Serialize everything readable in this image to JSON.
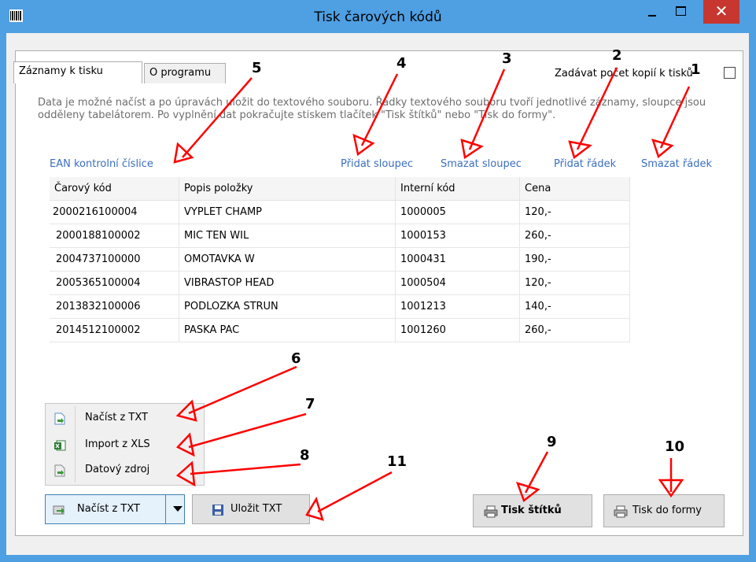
{
  "window": {
    "title": "Tisk čarových kódů"
  },
  "tabs": [
    {
      "label": "Záznamy k tisku"
    },
    {
      "label": "O programu"
    }
  ],
  "copies_option": {
    "label": "Zadávat počet kopií k tisků",
    "checked": false
  },
  "info_text": "Data je možné  načíst a po úpravách  uložit do  textového  souboru.  Řádky  textového souboru tvoří jednotlivé záznamy, sloupce jsou odděleny tabelátorem. Po vyplnění dat pokračujte stiskem tlačítek \"Tisk štítků\" nebo \"Tisk do formy\".",
  "links": {
    "ean_check": "EAN kontrolní číslice",
    "add_column": "Přidat sloupec",
    "delete_column": "Smazat sloupec",
    "add_row": "Přidat řádek",
    "delete_row": "Smazat řádek"
  },
  "table": {
    "columns": [
      "Čarový kód",
      "Popis položky",
      "Interní kód",
      "Cena"
    ],
    "rows": [
      [
        "2000216100004",
        "VYPLET CHAMP",
        "1000005",
        "120,-"
      ],
      [
        "2000188100002",
        "MIC TEN WIL",
        "1000153",
        "260,-"
      ],
      [
        "2004737100000",
        "OMOTAVKA W",
        "1000431",
        "190,-"
      ],
      [
        "2005365100004",
        "VIBRASTOP HEAD",
        "1000504",
        "120,-"
      ],
      [
        "2013832100006",
        "PODLOZKA STRUN",
        "1001213",
        "140,-"
      ],
      [
        "2014512100002",
        "PASKA PAC",
        "1001260",
        "260,-"
      ]
    ]
  },
  "load_menu": {
    "items": [
      {
        "label": "Načíst z TXT",
        "icon": "txt-load-icon"
      },
      {
        "label": "Import z XLS",
        "icon": "excel-icon"
      },
      {
        "label": "Datový zdroj",
        "icon": "datasource-icon"
      }
    ]
  },
  "buttons": {
    "load": "Načíst z TXT",
    "save": "Uložit TXT",
    "print_labels": "Tisk štítků",
    "print_form": "Tisk do formy"
  },
  "annotations": [
    "1",
    "2",
    "3",
    "4",
    "5",
    "6",
    "7",
    "8",
    "9",
    "10",
    "11"
  ],
  "colors": {
    "titlebar": "#4f9fe3",
    "close": "#c7372f",
    "link": "#3b6ebf",
    "annotation": "#ff0000"
  }
}
